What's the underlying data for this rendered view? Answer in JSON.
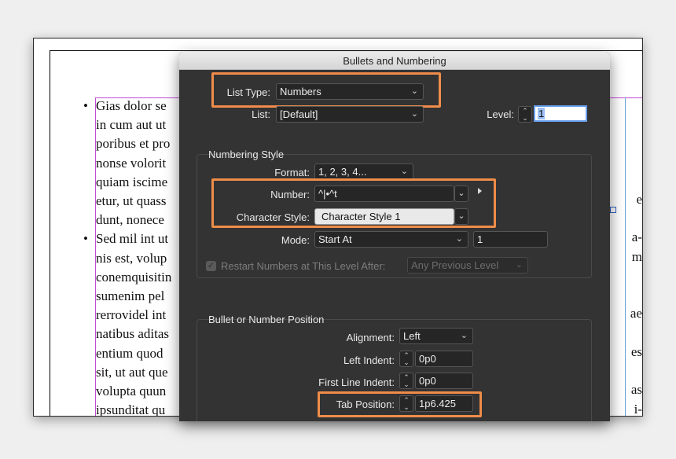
{
  "document": {
    "para1_lines": [
      "Gias dolor se",
      "in cum aut ut",
      "poribus et pro",
      "nonse volorit",
      "quiam iscime",
      "etur, ut quass",
      "dunt, nonece"
    ],
    "para2_lines": [
      "Sed mil int ut",
      "nis est, volup",
      "conemquisitin",
      "sumenim pel",
      "rerrovidel int",
      "natibus aditas",
      "entium quod",
      "sit, ut aut que",
      "volupta quun",
      "ipsunditat qu"
    ],
    "right_fragments": {
      "r1": "e",
      "r2": "a-",
      "r3": "m",
      "r4": "ae",
      "r5": "es",
      "r6": "as",
      "r7": "i-"
    },
    "bullet_char": "•"
  },
  "dialog": {
    "title": "Bullets and Numbering",
    "list_type_label": "List Type:",
    "list_type_value": "Numbers",
    "list_label": "List:",
    "list_value": "[Default]",
    "level_label": "Level:",
    "level_value": "1",
    "numbering_style": {
      "title": "Numbering Style",
      "format_label": "Format:",
      "format_value": "1, 2, 3, 4...",
      "number_label": "Number:",
      "number_value": "^|•^t",
      "char_style_label": "Character Style:",
      "char_style_value": "Character Style 1",
      "mode_label": "Mode:",
      "mode_value": "Start At",
      "mode_start_value": "1",
      "restart_label": "Restart Numbers at This Level After:",
      "restart_value": "Any Previous Level"
    },
    "position": {
      "title": "Bullet or Number Position",
      "alignment_label": "Alignment:",
      "alignment_value": "Left",
      "left_indent_label": "Left Indent:",
      "left_indent_value": "0p0",
      "first_line_label": "First Line Indent:",
      "first_line_value": "0p0",
      "tab_position_label": "Tab Position:",
      "tab_position_value": "1p6.425"
    }
  },
  "colors": {
    "highlight": "#ef8c4a",
    "dialog_bg": "#333333",
    "guide_magenta": "#c24ad8"
  },
  "icons": {
    "dropdown": "chevron-down-icon",
    "stepper": "stepper-arrows-icon",
    "flyout": "triangle-right-icon",
    "check": "checkbox-icon"
  }
}
